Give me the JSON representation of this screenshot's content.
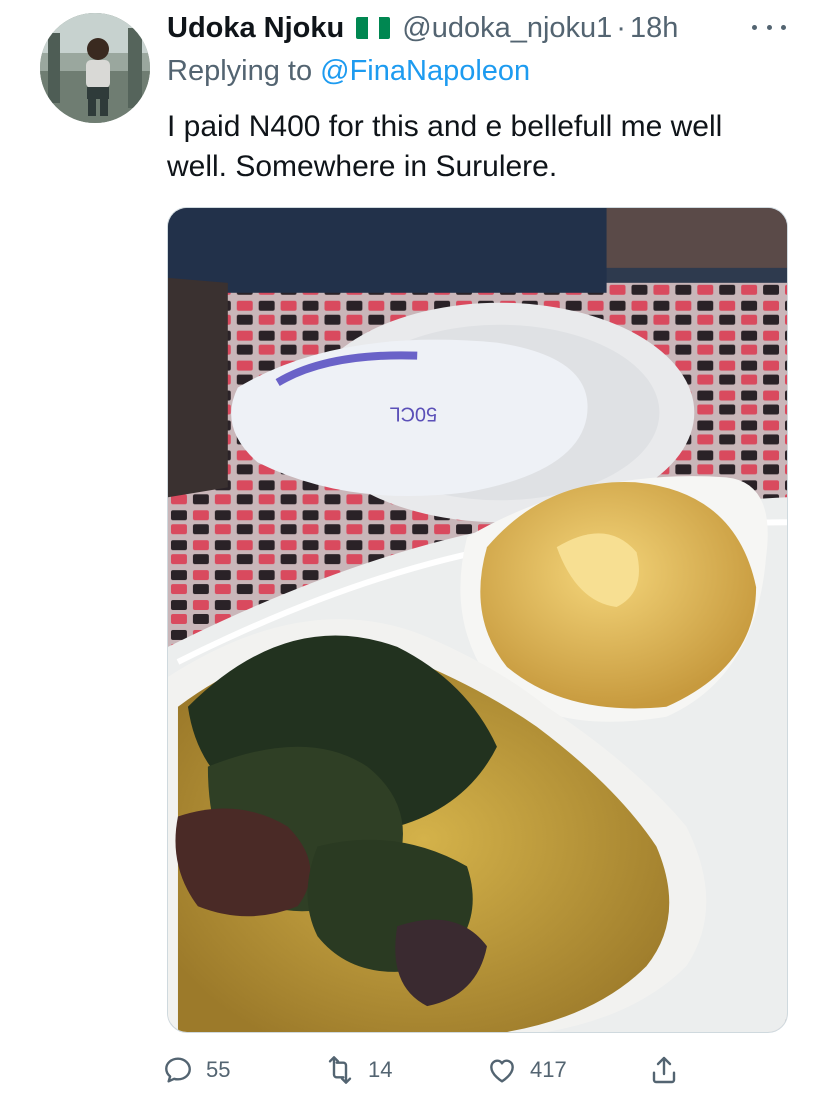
{
  "tweet": {
    "author_name": "Udoka Njoku",
    "flag_icon": "nigeria-flag-icon",
    "handle": "@udoka_njoku1",
    "separator": "·",
    "time": "18h",
    "replying_prefix": "Replying to ",
    "replying_to": "@FinaNapoleon",
    "text": "I paid N400 for this and e bellefull me well well. Somewhere in Surulere.",
    "photo_alt": "",
    "sachet_text": "50CL"
  },
  "actions": {
    "replies": "55",
    "retweets": "14",
    "likes": "417"
  },
  "colors": {
    "accent": "#1d9bf0",
    "secondary_text": "#536471",
    "primary_text": "#0f1419"
  }
}
